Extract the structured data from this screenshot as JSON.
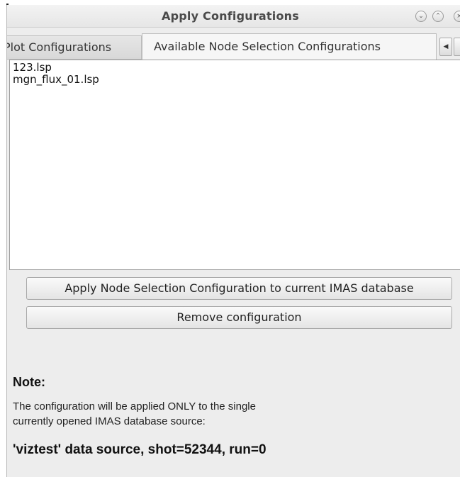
{
  "window": {
    "title": "Apply Configurations",
    "minimize_glyph": "⌄",
    "maximize_glyph": "⌃",
    "close_glyph": "×"
  },
  "tabs": [
    {
      "label": "Plot Configurations",
      "active": false
    },
    {
      "label": "Available Node Selection Configurations",
      "active": true
    }
  ],
  "tab_scroll_left_glyph": "◀",
  "configurations": [
    "123.lsp",
    "mgn_flux_01.lsp"
  ],
  "buttons": {
    "apply": "Apply Node Selection Configuration to current IMAS database",
    "remove": "Remove configuration"
  },
  "note": {
    "heading": "Note:",
    "line1": "The configuration will be applied ONLY to the single",
    "line2": "currently opened IMAS database source:",
    "source": "'viztest' data source, shot=52344, run=0"
  }
}
